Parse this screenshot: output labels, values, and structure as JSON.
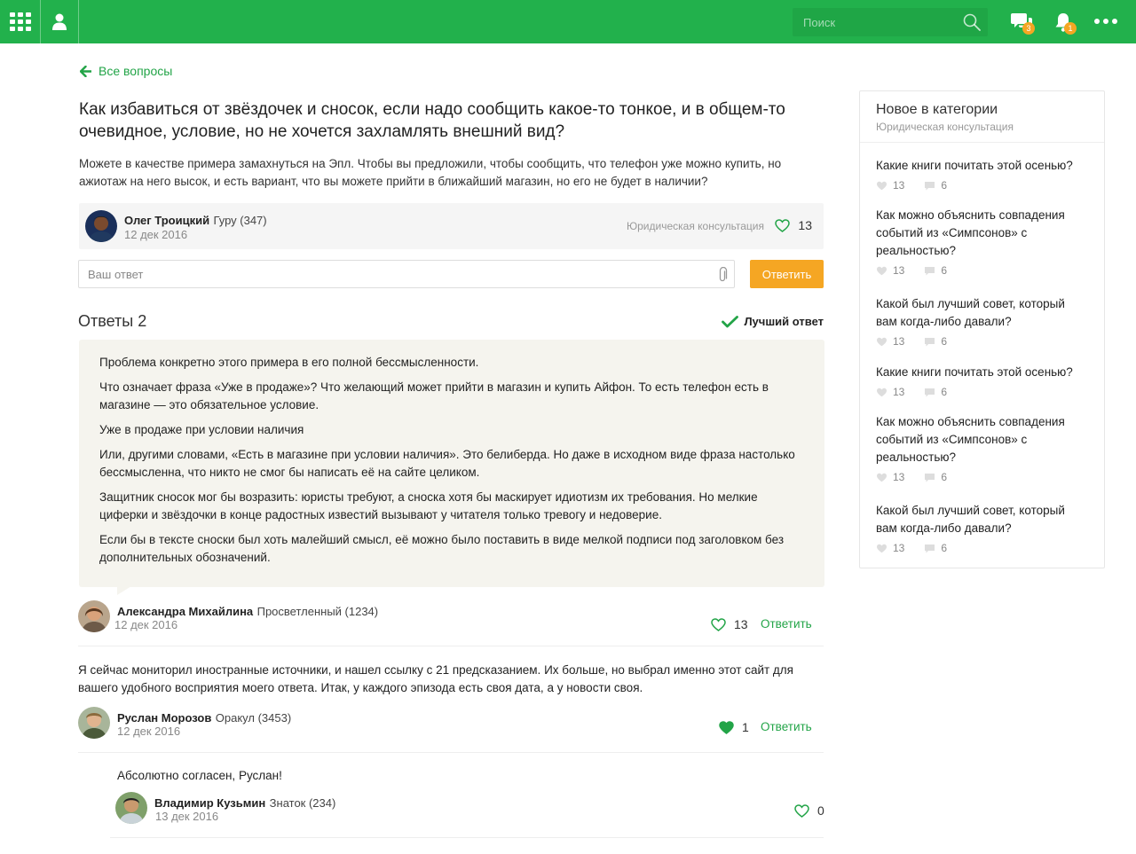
{
  "header": {
    "search_placeholder": "Поиск",
    "chat_badge": "3",
    "notif_badge": "1",
    "accent": "#22b14c"
  },
  "back_link": "Все вопросы",
  "question": {
    "title": "Как избавиться от звёздочек и сносок, если надо сообщить какое-то тонкое, и в общем-то очевидное, условие, но не хочется захламлять внешний вид?",
    "body": "Можете в качестве примера замахнуться на Эпл. Чтобы вы предложили, чтобы сообщить, что телефон уже можно купить, но ажиотаж на него высок, и есть вариант, что вы можете прийти в ближайший магазин, но его не будет в наличии?",
    "author": {
      "name": "Олег Троицкий",
      "rank": "Гуру (347)",
      "date": "12 дек 2016"
    },
    "category": "Юридическая консультация",
    "likes": "13"
  },
  "answer_form": {
    "placeholder": "Ваш ответ",
    "submit_label": "Ответить"
  },
  "answers": {
    "title": "Ответы 2",
    "best_label": "Лучший ответ",
    "best": {
      "paragraphs": [
        "Проблема конкретно этого примера в его полной бессмысленности.",
        "Что означает фраза «Уже в продаже»? Что желающий может прийти в магазин и купить Айфон. То есть телефон есть в магазине — это обязательное условие.",
        "Уже в продаже при условии наличия",
        "Или, другими словами, «Есть в магазине при условии наличия». Это белиберда. Но даже в исходном виде фраза настолько бессмысленна, что никто не смог бы написать её на сайте целиком.",
        "Защитник сносок мог бы возразить: юристы требуют, а сноска хотя бы маскирует идиотизм их требования. Но мелкие циферки и звёздочки в конце радостных известий вызывают у читателя только тревогу и недоверие.",
        "Если бы в тексте сноски был хоть малейший смысл, её можно было поставить в виде мелкой подписи под заголовком без дополнительных обозначений."
      ],
      "author": {
        "name": "Александра Михайлина",
        "rank": "Просветленный (1234)",
        "date": "12 дек 2016"
      },
      "likes": "13",
      "reply_label": "Ответить"
    },
    "second": {
      "text": "Я сейчас мониторил иностранные источники, и нашел ссылку с 21 предсказанием. Их больше, но выбрал именно этот сайт для вашего удобного восприятия моего ответа. Итак, у каждого эпизода есть своя дата, а у новости своя.",
      "author": {
        "name": "Руслан Морозов",
        "rank": "Оракул (3453)",
        "date": "12 дек 2016"
      },
      "likes": "1",
      "reply_label": "Ответить"
    },
    "comment": {
      "text": "Абсолютно согласен, Руслан!",
      "author": {
        "name": "Владимир Кузьмин",
        "rank": "Знаток (234)",
        "date": "13 дек 2016"
      },
      "likes": "0"
    }
  },
  "sidebar": {
    "title": "Новое в категории",
    "subtitle": "Юридическая консультация",
    "items": [
      {
        "question": "Какие книги почитать этой осенью?",
        "likes": "13",
        "comments": "6"
      },
      {
        "question": "Как можно объяснить совпадения событий из «Симпсонов» с реальностью?",
        "likes": "13",
        "comments": "6"
      },
      {
        "question": "Какой был лучший совет, который вам когда-либо давали?",
        "likes": "13",
        "comments": "6"
      },
      {
        "question": "Какие книги почитать этой осенью?",
        "likes": "13",
        "comments": "6"
      },
      {
        "question": "Как можно объяснить совпадения событий из «Симпсонов» с реальностью?",
        "likes": "13",
        "comments": "6"
      },
      {
        "question": "Какой был лучший совет, который вам когда-либо давали?",
        "likes": "13",
        "comments": "6"
      }
    ]
  }
}
